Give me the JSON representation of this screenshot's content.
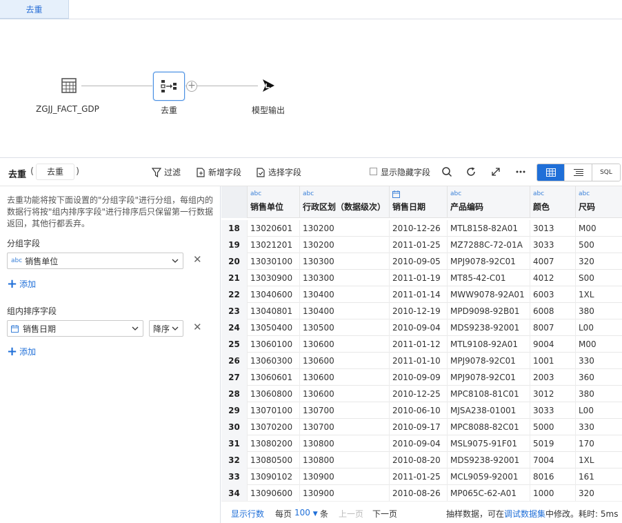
{
  "tab": {
    "label": "去重"
  },
  "flow": {
    "nodes": [
      {
        "label": "ZGJJ_FACT_GDP",
        "icon": "table-icon"
      },
      {
        "label": "去重",
        "icon": "dedupe-icon"
      },
      {
        "label": "模型输出",
        "icon": "output-icon"
      }
    ]
  },
  "toolbar": {
    "title": "去重",
    "paren_open": "(",
    "paren_close": ")",
    "node_name": "去重",
    "filter": "过滤",
    "add_field": "新增字段",
    "select_field": "选择字段",
    "show_hidden": "显示隐藏字段",
    "sql": "SQL"
  },
  "config": {
    "description": "去重功能将按下面设置的\"分组字段\"进行分组，每组内的数据行将按\"组内排序字段\"进行排序后只保留第一行数据返回，其他行都丢弃。",
    "group_label": "分组字段",
    "group_field": {
      "type": "abc",
      "value": "销售单位"
    },
    "add_label": "添加",
    "sort_label": "组内排序字段",
    "sort_field": {
      "value": "销售日期"
    },
    "sort_order": "降序"
  },
  "grid": {
    "columns": [
      {
        "type": "abc",
        "name": "销售单位"
      },
      {
        "type": "abc",
        "name": "行政区划（数据级次）"
      },
      {
        "type": "date",
        "name": "销售日期"
      },
      {
        "type": "abc",
        "name": "产品编码"
      },
      {
        "type": "abc",
        "name": "颜色"
      },
      {
        "type": "abc",
        "name": "尺码"
      }
    ],
    "rows": [
      [
        "18",
        "13020601",
        "130200",
        "2010-12-26",
        "MTL8158-82A01",
        "3013",
        "M00"
      ],
      [
        "19",
        "13021201",
        "130200",
        "2011-01-25",
        "MZ7288C-72-01A",
        "3033",
        "500"
      ],
      [
        "20",
        "13030100",
        "130300",
        "2010-09-05",
        "MPJ9078-92C01",
        "4007",
        "320"
      ],
      [
        "21",
        "13030900",
        "130300",
        "2011-01-19",
        "MT85-42-C01",
        "4012",
        "S00"
      ],
      [
        "22",
        "13040600",
        "130400",
        "2011-01-14",
        "MWW9078-92A01",
        "6003",
        "1XL"
      ],
      [
        "23",
        "13040801",
        "130400",
        "2010-12-19",
        "MPD9098-92B01",
        "6008",
        "380"
      ],
      [
        "24",
        "13050400",
        "130500",
        "2010-09-04",
        "MDS9238-92001",
        "8007",
        "L00"
      ],
      [
        "25",
        "13060100",
        "130600",
        "2011-01-12",
        "MTL9108-92A01",
        "9004",
        "M00"
      ],
      [
        "26",
        "13060300",
        "130600",
        "2011-01-10",
        "MPJ9078-92C01",
        "1001",
        "330"
      ],
      [
        "27",
        "13060601",
        "130600",
        "2010-09-09",
        "MPJ9078-92C01",
        "2003",
        "360"
      ],
      [
        "28",
        "13060800",
        "130600",
        "2010-12-25",
        "MPC8108-81C01",
        "3012",
        "380"
      ],
      [
        "29",
        "13070100",
        "130700",
        "2010-06-10",
        "MJSA238-01001",
        "3033",
        "L00"
      ],
      [
        "30",
        "13070200",
        "130700",
        "2010-09-17",
        "MPC8088-82C01",
        "5000",
        "330"
      ],
      [
        "31",
        "13080200",
        "130800",
        "2010-09-04",
        "MSL9075-91F01",
        "5019",
        "170"
      ],
      [
        "32",
        "13080500",
        "130800",
        "2010-08-20",
        "MDS9238-92001",
        "7004",
        "1XL"
      ],
      [
        "33",
        "13090102",
        "130900",
        "2011-01-25",
        "MCL9059-92001",
        "8016",
        "161"
      ],
      [
        "34",
        "13090600",
        "130900",
        "2010-08-26",
        "MP065C-62-A01",
        "1000",
        "320"
      ]
    ]
  },
  "pager": {
    "show_count": "显示行数",
    "per_page": "每页",
    "page_size": "100",
    "unit": "条",
    "prev": "上一页",
    "next": "下一页",
    "sample_prefix": "抽样数据，可在",
    "sample_link": "调试数据集",
    "sample_suffix": "中修改。耗时: 5ms"
  },
  "colors": {
    "accent": "#1f6fd8",
    "type": "#3a80d8"
  }
}
